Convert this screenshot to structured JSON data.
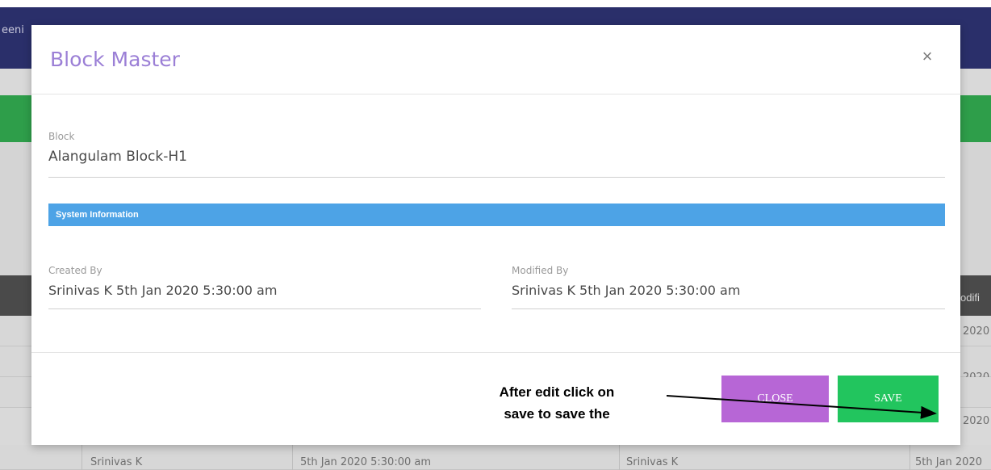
{
  "background": {
    "topbar_text": "eeni",
    "table_header_partial": "odifi",
    "rows": [
      {
        "right_cell": "2020"
      },
      {
        "right_cell": "2020"
      },
      {
        "right_cell": "2020"
      },
      {
        "created_by": "Srinivas K",
        "created_on": "5th Jan 2020 5:30:00 am",
        "modified_by": "Srinivas K",
        "modified_on": "5th Jan 2020"
      }
    ]
  },
  "modal": {
    "title": "Block Master",
    "close_icon": "×",
    "block": {
      "label": "Block",
      "value": "Alangulam Block-H1"
    },
    "section_title": "System Information",
    "created_by": {
      "label": "Created By",
      "value": "Srinivas K  5th Jan 2020 5:30:00 am"
    },
    "modified_by": {
      "label": "Modified By",
      "value": "Srinivas K  5th Jan 2020 5:30:00 am"
    },
    "buttons": {
      "close": "CLOSE",
      "save": "SAVE"
    }
  },
  "annotation": {
    "line1": "After edit click on",
    "line2": "save to save the"
  },
  "colors": {
    "title": "#9b7fd6",
    "section_bar": "#4da3e6",
    "close_button": "#b766d6",
    "save_button": "#22c55e",
    "topbar": "#2a2f6a",
    "green_bar": "#2e9e4a"
  }
}
